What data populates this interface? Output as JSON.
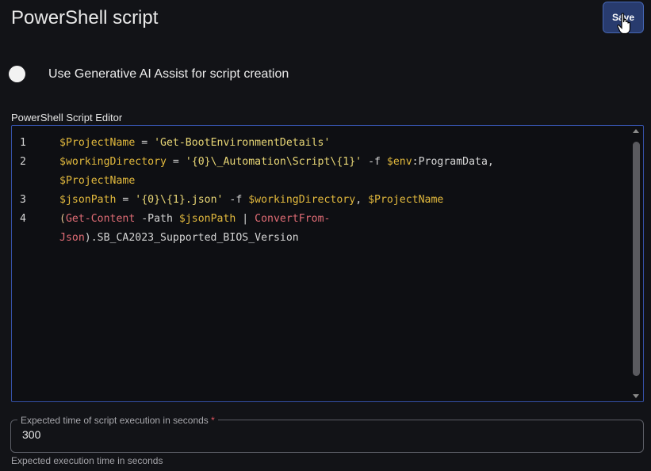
{
  "header": {
    "title": "PowerShell script",
    "save_label": "Save"
  },
  "ai_assist": {
    "label": "Use Generative AI Assist for script creation",
    "enabled": false
  },
  "editor": {
    "label": "PowerShell Script Editor",
    "line_numbers": [
      "1",
      "2",
      "3",
      "4"
    ],
    "lines": [
      [
        {
          "t": "$ProjectName",
          "c": "var"
        },
        {
          "t": " = ",
          "c": "txt"
        },
        {
          "t": "'Get-BootEnvironmentDetails'",
          "c": "str"
        }
      ],
      [
        {
          "t": "$workingDirectory",
          "c": "var"
        },
        {
          "t": " = ",
          "c": "txt"
        },
        {
          "t": "'{0}\\_Automation\\Script\\{1}'",
          "c": "str"
        },
        {
          "t": " -f ",
          "c": "txt"
        },
        {
          "t": "$env",
          "c": "var"
        },
        {
          "t": ":ProgramData,",
          "c": "txt"
        }
      ],
      [
        {
          "t": "$ProjectName",
          "c": "var"
        }
      ],
      [
        {
          "t": "$jsonPath",
          "c": "var"
        },
        {
          "t": " = ",
          "c": "txt"
        },
        {
          "t": "'{0}\\{1}.json'",
          "c": "str"
        },
        {
          "t": " -f ",
          "c": "txt"
        },
        {
          "t": "$workingDirectory",
          "c": "var"
        },
        {
          "t": ", ",
          "c": "txt"
        },
        {
          "t": "$ProjectName",
          "c": "var"
        }
      ],
      [
        {
          "t": "(",
          "c": "op"
        },
        {
          "t": "Get-Content",
          "c": "cmd"
        },
        {
          "t": " -Path ",
          "c": "txt"
        },
        {
          "t": "$jsonPath",
          "c": "var"
        },
        {
          "t": " | ",
          "c": "txt"
        },
        {
          "t": "ConvertFrom-",
          "c": "cmd"
        }
      ],
      [
        {
          "t": "Json",
          "c": "cmd"
        },
        {
          "t": ").SB_CA2023_Supported_BIOS_Version",
          "c": "txt"
        }
      ]
    ]
  },
  "execution_time": {
    "label": "Expected time of script execution in seconds",
    "required_marker": "*",
    "value": "300",
    "helper": "Expected execution time in seconds"
  }
}
